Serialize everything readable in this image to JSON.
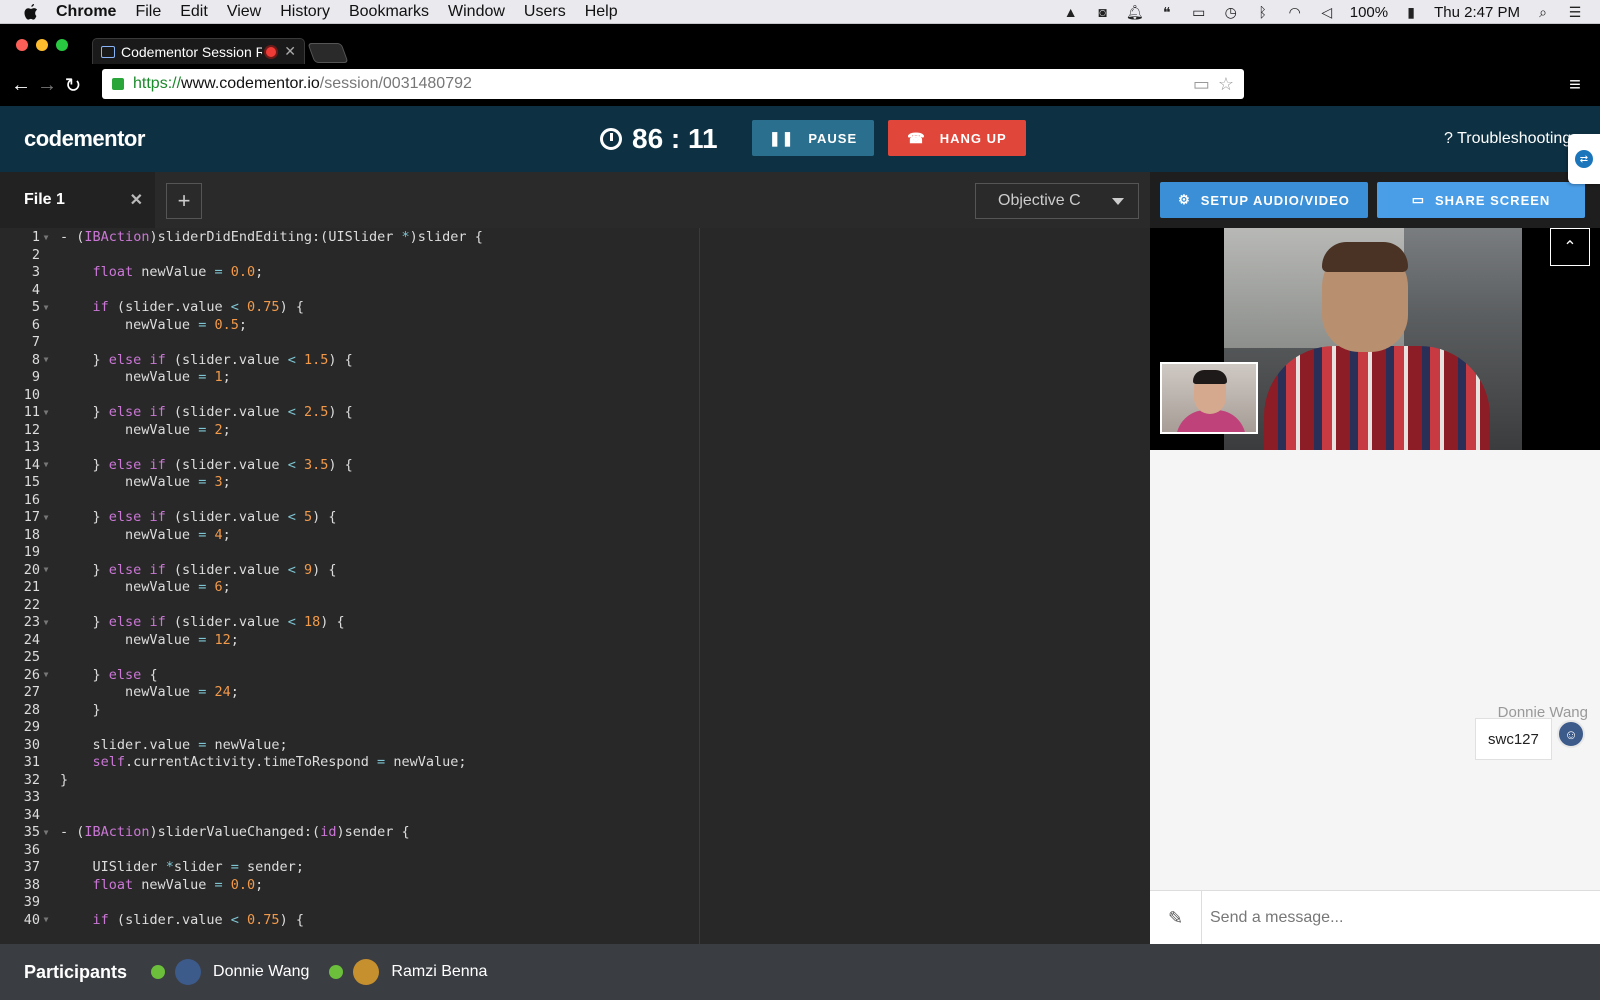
{
  "menubar": {
    "app": "Chrome",
    "items": [
      "File",
      "Edit",
      "View",
      "History",
      "Bookmarks",
      "Window",
      "Users",
      "Help"
    ],
    "battery": "100%",
    "clock": "Thu 2:47 PM"
  },
  "browser": {
    "tab_title": "Codementor Session Ro",
    "url_scheme": "https://",
    "url_host": "www.codementor.io",
    "url_path": "/session/0031480792"
  },
  "header": {
    "logo": "codementor",
    "timer": "86 : 11",
    "pause_label": "PAUSE",
    "hangup_label": "HANG UP",
    "troubleshooting_label": "Troubleshooting"
  },
  "editor": {
    "file_tab": "File 1",
    "language": "Objective C"
  },
  "code_lines": [
    "- (IBAction)sliderDidEndEditing:(UISlider *)slider {",
    "",
    "    float newValue = 0.0;",
    "",
    "    if (slider.value < 0.75) {",
    "        newValue = 0.5;",
    "",
    "    } else if (slider.value < 1.5) {",
    "        newValue = 1;",
    "",
    "    } else if (slider.value < 2.5) {",
    "        newValue = 2;",
    "",
    "    } else if (slider.value < 3.5) {",
    "        newValue = 3;",
    "",
    "    } else if (slider.value < 5) {",
    "        newValue = 4;",
    "",
    "    } else if (slider.value < 9) {",
    "        newValue = 6;",
    "",
    "    } else if (slider.value < 18) {",
    "        newValue = 12;",
    "",
    "    } else {",
    "        newValue = 24;",
    "    }",
    "",
    "    slider.value = newValue;",
    "    self.currentActivity.timeToRespond = newValue;",
    "}",
    "",
    "",
    "- (IBAction)sliderValueChanged:(id)sender {",
    "",
    "    UISlider *slider = sender;",
    "    float newValue = 0.0;",
    "",
    "    if (slider.value < 0.75) {"
  ],
  "fold_lines": [
    1,
    5,
    8,
    11,
    14,
    17,
    20,
    23,
    26,
    35,
    40
  ],
  "right_panel": {
    "setup_label": "SETUP AUDIO/VIDEO",
    "share_label": "SHARE SCREEN"
  },
  "chat": {
    "sender": "Donnie Wang",
    "message": "swc127",
    "placeholder": "Send a message..."
  },
  "participants": {
    "title": "Participants",
    "people": [
      {
        "name": "Donnie Wang",
        "avatar_color": "#3c5a8a"
      },
      {
        "name": "Ramzi Benna",
        "avatar_color": "#c7902e"
      }
    ]
  },
  "colors": {
    "header_bg": "#0d3143",
    "pause_bg": "#2b6f8e",
    "hangup_bg": "#e0463a",
    "setup_bg": "#3a8fd6",
    "share_bg": "#4a9ee8",
    "keyword": "#cb77d6",
    "number": "#f29a4a",
    "online": "#6bbf3b"
  }
}
